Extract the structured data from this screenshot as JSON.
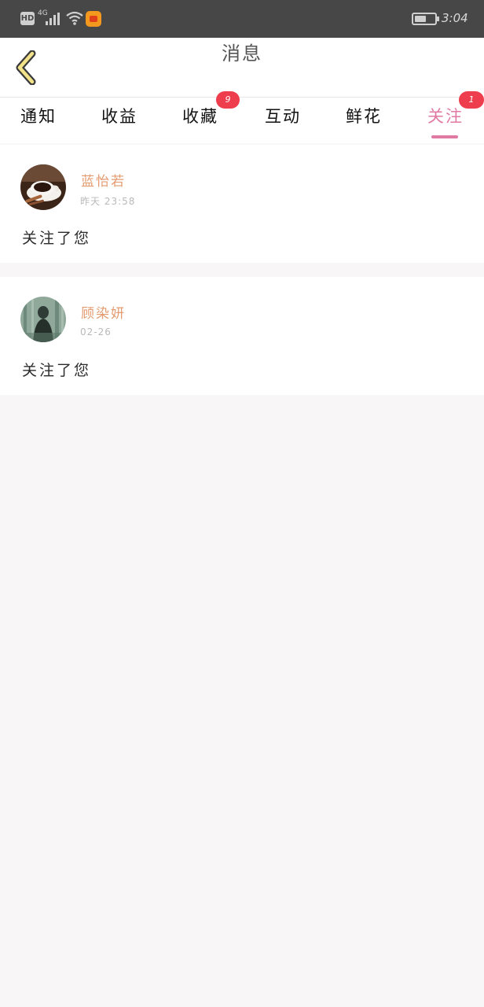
{
  "status_bar": {
    "hd": "HD",
    "network": "4G",
    "time": "3:04"
  },
  "header": {
    "title": "消息"
  },
  "tabs": [
    {
      "label": "通知",
      "badge": ""
    },
    {
      "label": "收益",
      "badge": ""
    },
    {
      "label": "收藏",
      "badge": "9"
    },
    {
      "label": "互动",
      "badge": ""
    },
    {
      "label": "鲜花",
      "badge": ""
    },
    {
      "label": "关注",
      "badge": "1"
    }
  ],
  "messages": [
    {
      "name": "蓝怡若",
      "time": "昨天 23:58",
      "text": "关注了您"
    },
    {
      "name": "顾染妍",
      "time": "02-26",
      "text": "关注了您"
    }
  ],
  "colors": {
    "accent": "#e07aa3",
    "name": "#e39b6f",
    "badge": "#ee3d4c"
  },
  "icons": {
    "back": "chevron-left-icon"
  }
}
